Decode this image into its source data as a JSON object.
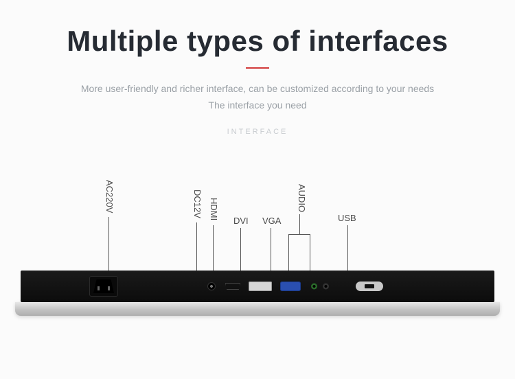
{
  "title": "Multiple types of interfaces",
  "subtitle_line1": "More user-friendly and richer interface, can be customized according to your needs",
  "subtitle_line2": "The interface you need",
  "interface_label": "INTERFACE",
  "ports": {
    "ac": "AC220V",
    "dc": "DC12V",
    "hdmi": "HDMI",
    "dvi": "DVI",
    "vga": "VGA",
    "audio": "AUDIO",
    "usb": "USB"
  }
}
